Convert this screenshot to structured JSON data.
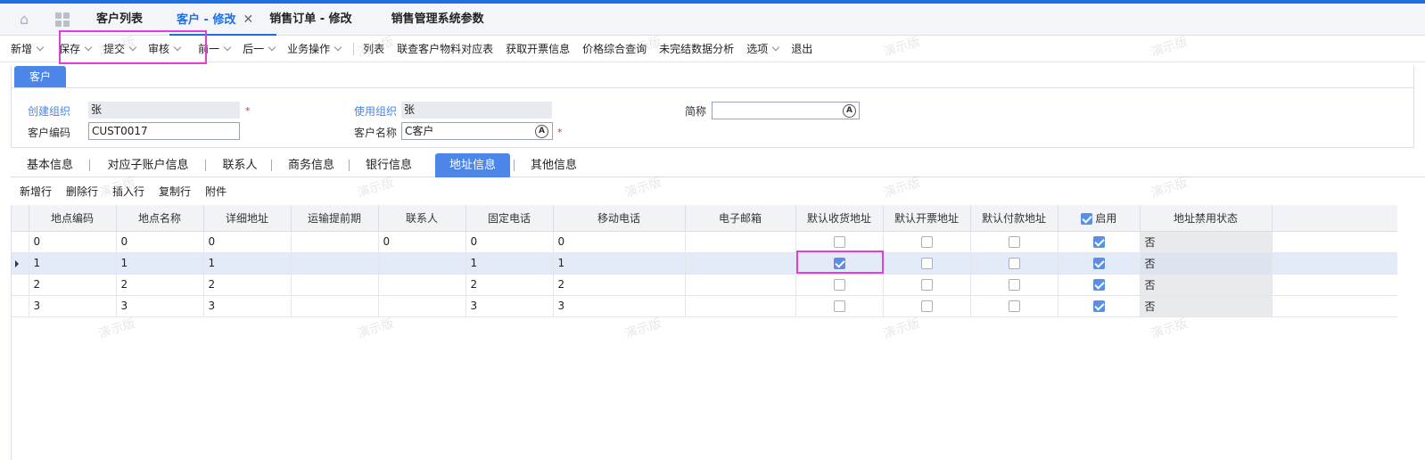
{
  "tabs": [
    {
      "label": "客户列表"
    },
    {
      "label": "客户 - 修改",
      "close": "✕"
    },
    {
      "label": "销售订单 - 修改"
    },
    {
      "label": "销售管理系统参数"
    }
  ],
  "toolbar": {
    "items": [
      "新增",
      "保存",
      "提交",
      "审核",
      "前一",
      "后一",
      "业务操作"
    ],
    "plain": [
      "列表",
      "联查客户物料对应表",
      "获取开票信息",
      "价格综合查询",
      "未完结数据分析"
    ],
    "options": "选项",
    "exit": "退出"
  },
  "header": {
    "tab": "客户",
    "create_org_label": "创建组织",
    "create_org_value": "张",
    "use_org_label": "使用组织",
    "use_org_value": "张",
    "short_name_label": "简称",
    "short_name_value": "",
    "code_label": "客户编码",
    "code_value": "CUST0017",
    "name_label": "客户名称",
    "name_value": "C客户",
    "lookup_glyph": "A",
    "required_mark": "*"
  },
  "subtabs": [
    "基本信息",
    "对应子账户信息",
    "联系人",
    "商务信息",
    "银行信息",
    "地址信息",
    "其他信息"
  ],
  "row_tools": [
    "新增行",
    "删除行",
    "插入行",
    "复制行",
    "附件"
  ],
  "grid": {
    "columns": [
      "地点编码",
      "地点名称",
      "详细地址",
      "运输提前期",
      "联系人",
      "固定电话",
      "移动电话",
      "电子邮箱",
      "默认收货地址",
      "默认开票地址",
      "默认付款地址",
      "启用",
      "地址禁用状态"
    ],
    "rows": [
      {
        "code": "0",
        "name": "0",
        "addr": "0",
        "lead": "",
        "contact": "0",
        "phone": "0",
        "mobile": "0",
        "email": "",
        "ship": false,
        "invoice": false,
        "pay": false,
        "enabled": true,
        "status": "否"
      },
      {
        "code": "1",
        "name": "1",
        "addr": "1",
        "lead": "",
        "contact": "",
        "phone": "1",
        "mobile": "1",
        "email": "",
        "ship": true,
        "invoice": false,
        "pay": false,
        "enabled": true,
        "status": "否"
      },
      {
        "code": "2",
        "name": "2",
        "addr": "2",
        "lead": "",
        "contact": "",
        "phone": "2",
        "mobile": "2",
        "email": "",
        "ship": false,
        "invoice": false,
        "pay": false,
        "enabled": true,
        "status": "否"
      },
      {
        "code": "3",
        "name": "3",
        "addr": "3",
        "lead": "",
        "contact": "",
        "phone": "3",
        "mobile": "3",
        "email": "",
        "ship": false,
        "invoice": false,
        "pay": false,
        "enabled": true,
        "status": "否"
      }
    ],
    "selected_row": 1
  },
  "watermark": "演示版",
  "colors": {
    "accent": "#1e6fe0",
    "highlight": "#e040d9"
  }
}
